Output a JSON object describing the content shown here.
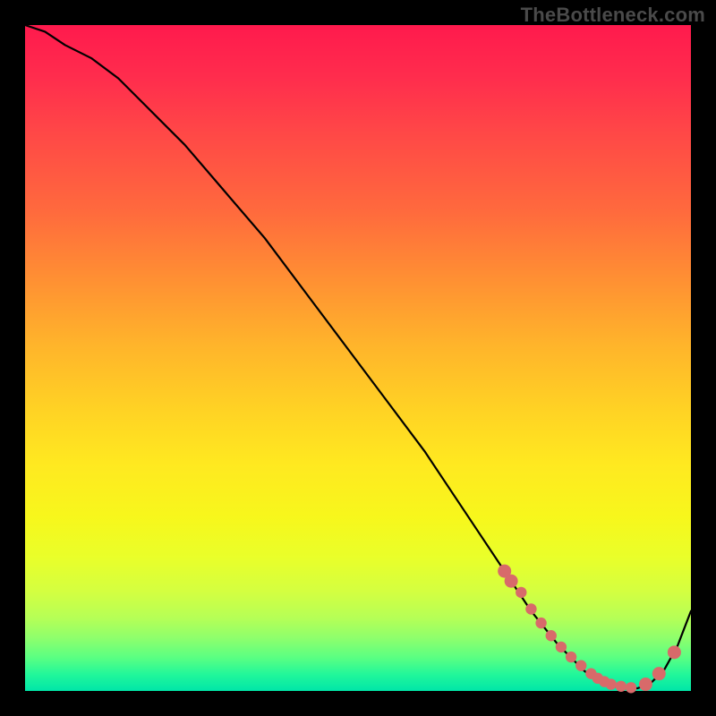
{
  "watermark": "TheBottleneck.com",
  "colors": {
    "dot": "#d86a6a",
    "curve": "#000000"
  },
  "chart_data": {
    "type": "line",
    "title": "",
    "xlabel": "",
    "ylabel": "",
    "xlim": [
      0,
      100
    ],
    "ylim": [
      0,
      100
    ],
    "grid": false,
    "legend": false,
    "series": [
      {
        "name": "bottleneck-curve",
        "x": [
          0,
          3,
          6,
          10,
          14,
          18,
          24,
          30,
          36,
          42,
          48,
          54,
          60,
          64,
          68,
          72,
          76,
          80,
          84,
          86,
          88,
          90,
          92,
          94,
          96,
          98,
          100
        ],
        "y": [
          100,
          99,
          97,
          95,
          92,
          88,
          82,
          75,
          68,
          60,
          52,
          44,
          36,
          30,
          24,
          18,
          12,
          7,
          3,
          1.6,
          0.8,
          0.4,
          0.4,
          1.2,
          3.2,
          6.8,
          12
        ]
      }
    ],
    "highlight_dots": {
      "name": "trough-dots",
      "x": [
        72,
        73,
        74.5,
        76,
        77.5,
        79,
        80.5,
        82,
        83.5,
        85,
        86,
        87,
        88,
        89.5,
        91,
        93.2,
        95.2,
        97.5
      ],
      "y": [
        18,
        16.5,
        14.8,
        12.3,
        10.2,
        8.3,
        6.6,
        5.1,
        3.8,
        2.6,
        1.9,
        1.4,
        1.0,
        0.7,
        0.5,
        1.0,
        2.6,
        5.8
      ]
    }
  }
}
